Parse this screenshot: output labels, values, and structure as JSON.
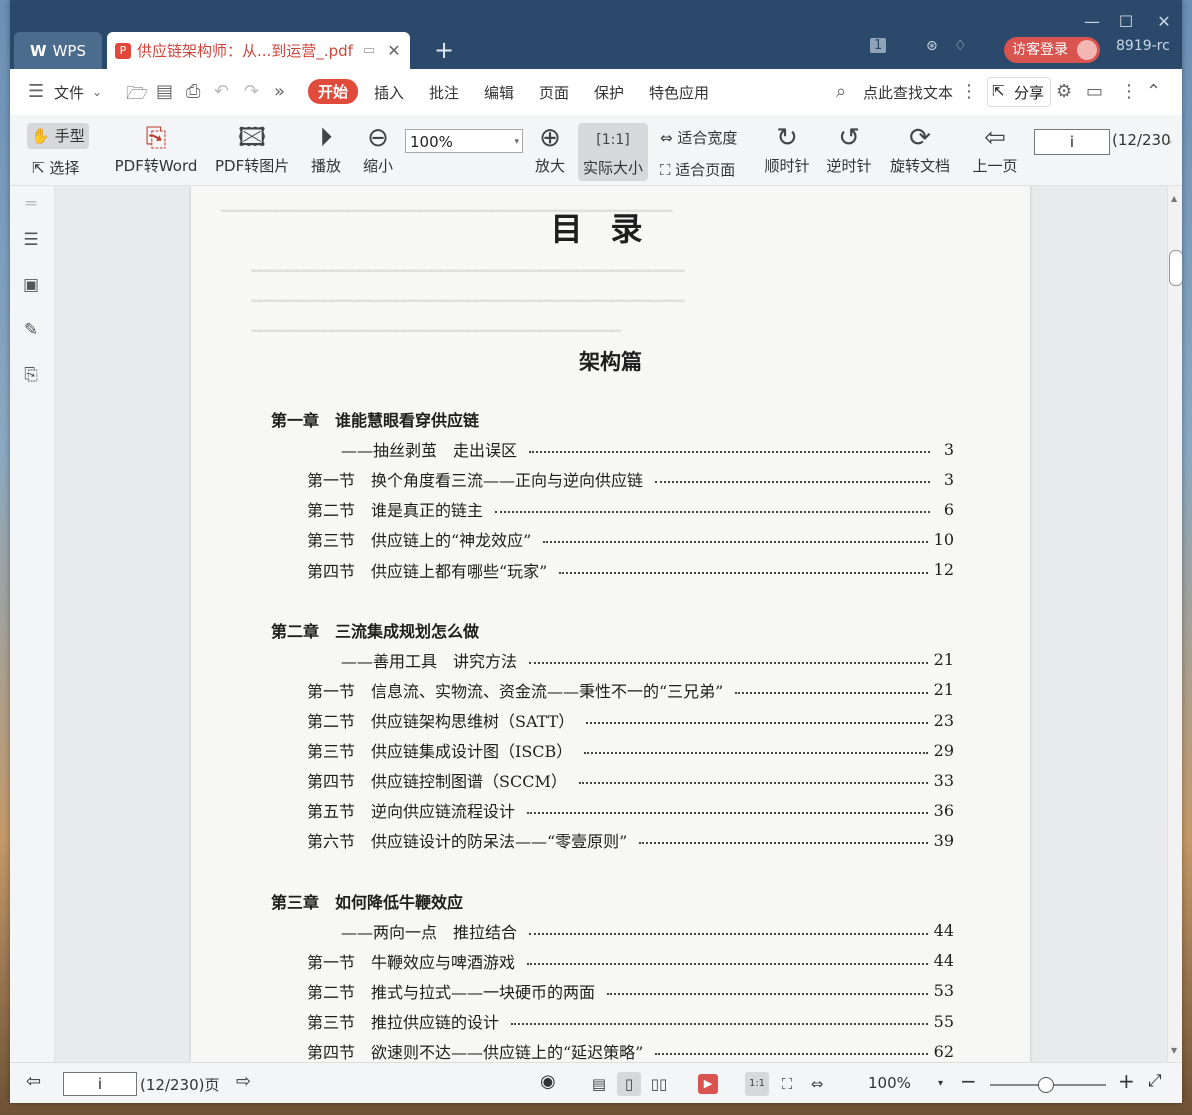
{
  "window": {
    "app_tab": "WPS",
    "doc_tab": "供应链架构师：从...到运营_.pdf",
    "right_num": "1",
    "login": "访客登录",
    "user_id": "8919-rc"
  },
  "menu": {
    "file": "文件",
    "items": [
      "开始",
      "插入",
      "批注",
      "编辑",
      "页面",
      "保护",
      "特色应用"
    ],
    "search": "点此查找文本",
    "share": "分享"
  },
  "toolbar": {
    "hand": "手型",
    "select": "选择",
    "pdf_to_word": "PDF转Word",
    "pdf_to_image": "PDF转图片",
    "play": "播放",
    "zoom_out": "缩小",
    "zoom_value": "100%",
    "zoom_in": "放大",
    "actual_size": "实际大小",
    "fit_width": "适合宽度",
    "fit_page": "适合页面",
    "clockwise": "顺时针",
    "counter_clockwise": "逆时针",
    "rotate_doc": "旋转文档",
    "prev_page": "上一页",
    "page_input": "i",
    "page_count": "(12/230"
  },
  "page": {
    "title": "目录",
    "part": "架构篇",
    "toc": [
      {
        "type": "chapter",
        "label": "第一章　谁能慧眼看穿供应链",
        "page": ""
      },
      {
        "type": "sub",
        "label": "——抽丝剥茧　走出误区",
        "page": "3"
      },
      {
        "type": "section",
        "label": "第一节　换个角度看三流——正向与逆向供应链",
        "page": "3"
      },
      {
        "type": "section",
        "label": "第二节　谁是真正的链主",
        "page": "6"
      },
      {
        "type": "section",
        "label": "第三节　供应链上的“神龙效应”",
        "page": "10"
      },
      {
        "type": "section",
        "label": "第四节　供应链上都有哪些“玩家”",
        "page": "12"
      },
      {
        "type": "chapter",
        "label": "第二章　三流集成规划怎么做",
        "page": ""
      },
      {
        "type": "sub",
        "label": "——善用工具　讲究方法",
        "page": "21"
      },
      {
        "type": "section",
        "label": "第一节　信息流、实物流、资金流——秉性不一的“三兄弟”",
        "page": "21"
      },
      {
        "type": "section",
        "label": "第二节　供应链架构思维树（SATT）",
        "page": "23"
      },
      {
        "type": "section",
        "label": "第三节　供应链集成设计图（ISCB）",
        "page": "29"
      },
      {
        "type": "section",
        "label": "第四节　供应链控制图谱（SCCM）",
        "page": "33"
      },
      {
        "type": "section",
        "label": "第五节　逆向供应链流程设计",
        "page": "36"
      },
      {
        "type": "section",
        "label": "第六节　供应链设计的防呆法——“零壹原则”",
        "page": "39"
      },
      {
        "type": "chapter",
        "label": "第三章　如何降低牛鞭效应",
        "page": ""
      },
      {
        "type": "sub",
        "label": "——两向一点　推拉结合",
        "page": "44"
      },
      {
        "type": "section",
        "label": "第一节　牛鞭效应与啤酒游戏",
        "page": "44"
      },
      {
        "type": "section",
        "label": "第二节　推式与拉式——一块硬币的两面",
        "page": "53"
      },
      {
        "type": "section",
        "label": "第三节　推拉供应链的设计",
        "page": "55"
      },
      {
        "type": "section",
        "label": "第四节　欲速则不达——供应链上的“延迟策略”",
        "page": "62"
      }
    ]
  },
  "status": {
    "page_input": "i",
    "page_info": "(12/230)页",
    "zoom": "100%"
  }
}
